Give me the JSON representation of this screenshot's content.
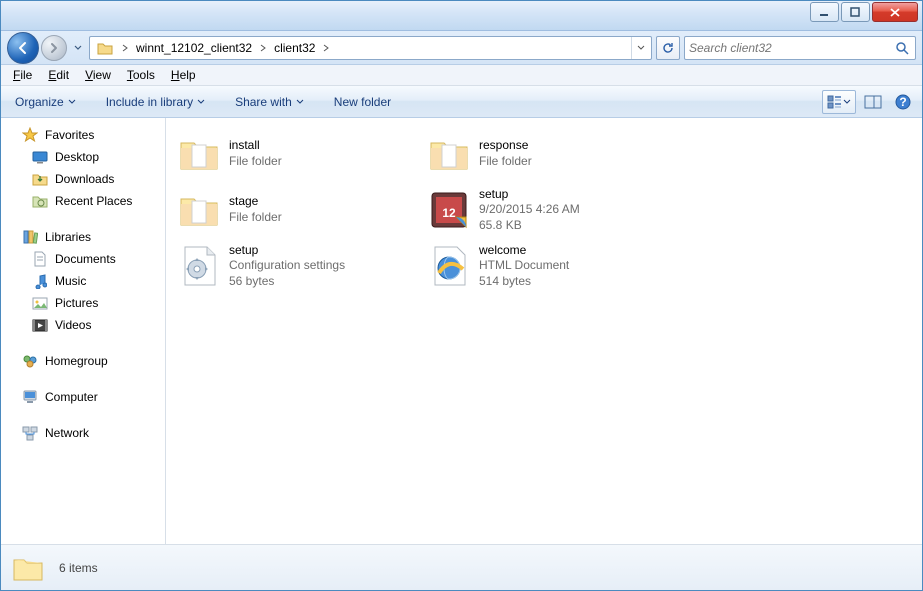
{
  "breadcrumbs": [
    "winnt_12102_client32",
    "client32"
  ],
  "search_placeholder": "Search client32",
  "menu": {
    "file": "File",
    "edit": "Edit",
    "view": "View",
    "tools": "Tools",
    "help": "Help"
  },
  "toolbar": {
    "organize": "Organize",
    "include": "Include in library",
    "share": "Share with",
    "newfolder": "New folder"
  },
  "nav": {
    "favorites": {
      "label": "Favorites",
      "items": [
        "Desktop",
        "Downloads",
        "Recent Places"
      ]
    },
    "libraries": {
      "label": "Libraries",
      "items": [
        "Documents",
        "Music",
        "Pictures",
        "Videos"
      ]
    },
    "homegroup": {
      "label": "Homegroup"
    },
    "computer": {
      "label": "Computer"
    },
    "network": {
      "label": "Network"
    }
  },
  "files": [
    {
      "name": "install",
      "line2": "File folder",
      "line3": "",
      "icon": "folder"
    },
    {
      "name": "response",
      "line2": "File folder",
      "line3": "",
      "icon": "folder"
    },
    {
      "name": "stage",
      "line2": "File folder",
      "line3": "",
      "icon": "folder"
    },
    {
      "name": "setup",
      "line2": "9/20/2015 4:26 AM",
      "line3": "65.8 KB",
      "icon": "exe"
    },
    {
      "name": "setup",
      "line2": "Configuration settings",
      "line3": "56 bytes",
      "icon": "ini"
    },
    {
      "name": "welcome",
      "line2": "HTML Document",
      "line3": "514 bytes",
      "icon": "html"
    }
  ],
  "status": "6 items"
}
